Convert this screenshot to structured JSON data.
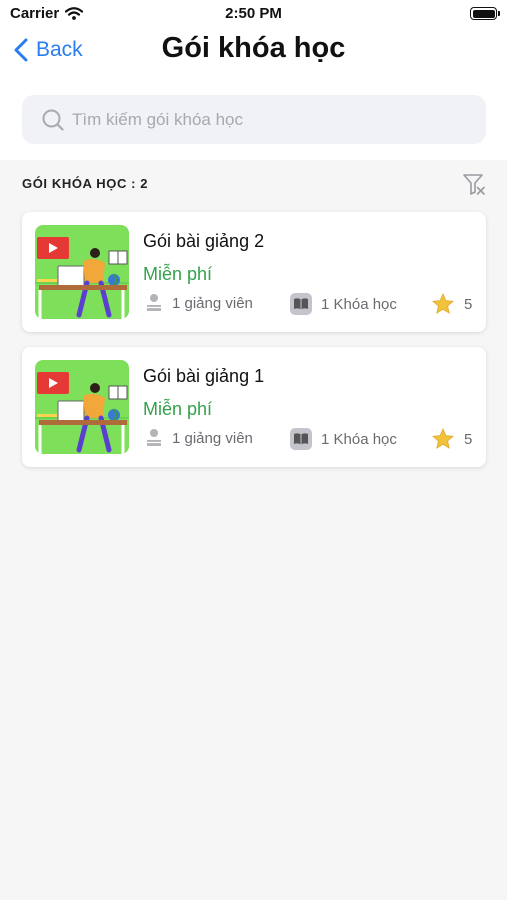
{
  "status_bar": {
    "carrier": "Carrier",
    "time": "2:50 PM"
  },
  "nav": {
    "back_label": "Back",
    "title": "Gói khóa học"
  },
  "search": {
    "placeholder": "Tìm kiếm gói khóa học",
    "value": ""
  },
  "section": {
    "count_label": "GÓI KHÓA HỌC : 2"
  },
  "packages": [
    {
      "title": "Gói bài giảng 2",
      "price": "Miễn phí",
      "teachers": "1 giảng viên",
      "courses": "1 Khóa học",
      "rating": "5"
    },
    {
      "title": "Gói bài giảng 1",
      "price": "Miễn phí",
      "teachers": "1 giảng viên",
      "courses": "1 Khóa học",
      "rating": "5"
    }
  ],
  "icons": {
    "back": "chevron-left-icon",
    "search": "search-icon",
    "filter": "filter-icon",
    "teacher": "teacher-icon",
    "course": "book-icon",
    "rating": "star-icon"
  },
  "colors": {
    "accent": "#2a7df0",
    "price": "#33a24a",
    "thumbnail_bg": "#7ee05a",
    "star": "#f2c23b"
  }
}
